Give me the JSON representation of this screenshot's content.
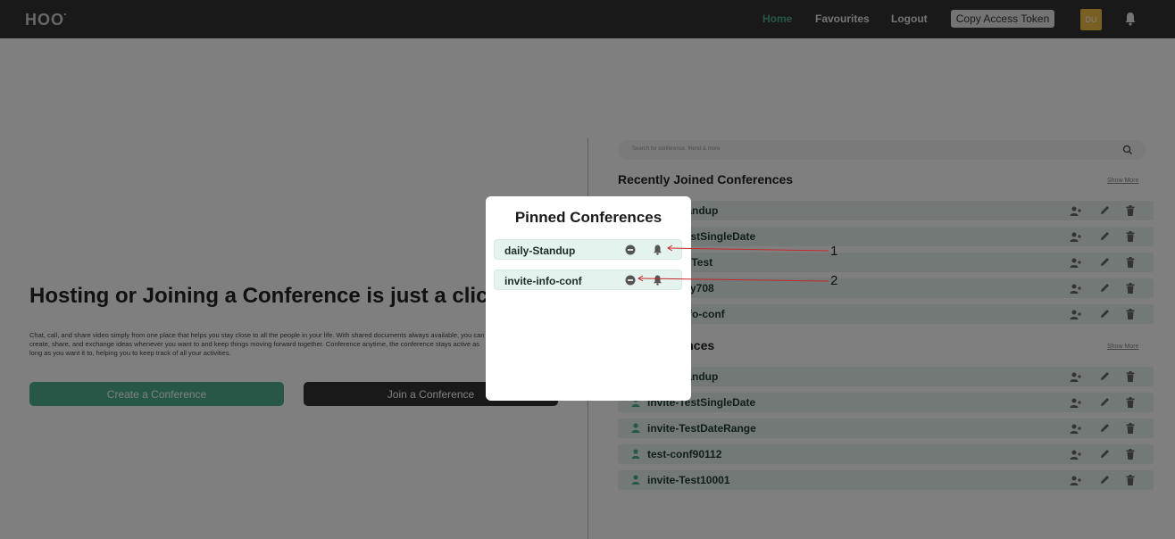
{
  "navbar": {
    "logo_text": "HOOT",
    "links": [
      "Home",
      "Favourites",
      "Logout"
    ],
    "copy_token_label": "Copy Access Token",
    "avatar_initials": "DU",
    "accent_color": "#4fae8f"
  },
  "hero": {
    "title": "Hosting or Joining a Conference is just a click a",
    "description": "Chat, call, and share video simply from one place that helps you stay close to all the people in your life. With shared documents always available, you can create, share, and exchange ideas whenever you want to and keep things moving forward together. Conference anytime, the conference stays active as long as you want it to, helping you to keep track of all your activities.",
    "create_button": "Create a Conference",
    "join_button": "Join a Conference"
  },
  "search": {
    "placeholder": "Search for conference, friend & more"
  },
  "recent": {
    "title": "Recently Joined Conferences",
    "show_more": "Show More",
    "items": [
      "daily-Standup",
      "invite-TestSingleDate",
      "conf-001Test",
      "test-party708",
      "invite-info-conf"
    ]
  },
  "my_conferences": {
    "title": "My Conferences",
    "show_more": "Show More",
    "items": [
      "daily-Standup",
      "invite-TestSingleDate",
      "invite-TestDateRange",
      "test-conf90112",
      "invite-Test10001"
    ]
  },
  "modal": {
    "title": "Pinned Conferences",
    "items": [
      "daily-Standup",
      "invite-info-conf"
    ]
  },
  "annotations": [
    "1",
    "2"
  ]
}
